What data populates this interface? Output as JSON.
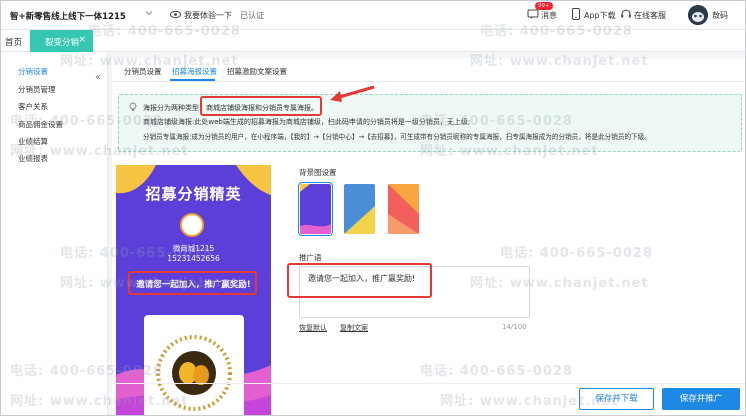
{
  "header": {
    "company": "智+新零售线上线下一体1215",
    "experience": "我要体验一下",
    "certified": "已认证",
    "messages": "消息",
    "messages_badge": "99+",
    "app_download": "App下载",
    "customer_service": "在线客服",
    "user": "敖码"
  },
  "tabs": {
    "home": "首页",
    "active": "裂变分销"
  },
  "sidebar": {
    "items": [
      {
        "label": "分销设置"
      },
      {
        "label": "分销员管理"
      },
      {
        "label": "客户关系"
      },
      {
        "label": "商品佣金设置"
      },
      {
        "label": "业绩结算"
      },
      {
        "label": "业绩报表"
      }
    ]
  },
  "subtabs": [
    {
      "label": "分销员设置"
    },
    {
      "label": "招募海报设置"
    },
    {
      "label": "招募激励文案设置"
    }
  ],
  "info": {
    "line1": "海报分为两种类型：商城店铺级海报和分销员专属海报。",
    "line2": "商城店铺级海报:此处web端生成的招募海报为商城店铺级，扫此码申请的分销员将是一级分销员，无上级;",
    "line3": "分销员专属海报:成为分销员的用户，在小程序端，【我的】→【分销中心】→【去招募】，可生成带有分销员昵称的专属海报，扫专属海报成为的分销员，将是此分销员的下级。"
  },
  "poster": {
    "title": "招募分销精英",
    "shop_name": "微商城1215",
    "phone": "15231452656",
    "slogan": "邀请您一起加入，推广赢奖励!"
  },
  "bg_settings": {
    "label": "背景图设置"
  },
  "promo": {
    "label": "推广语",
    "text": "邀请您一起加入，推广赢奖励!",
    "restore": "恢复默认",
    "copy": "复制文案",
    "count": "14/100"
  },
  "actions": {
    "save_download": "保存并下载",
    "save_promote": "保存并推广"
  },
  "watermark": {
    "phone": "电话: 400-665-0028",
    "site": "网址: www.chanjet.net"
  },
  "colors": {
    "accent": "#1e88e5",
    "tab_active": "#36c7b3",
    "highlight": "#e53935"
  }
}
